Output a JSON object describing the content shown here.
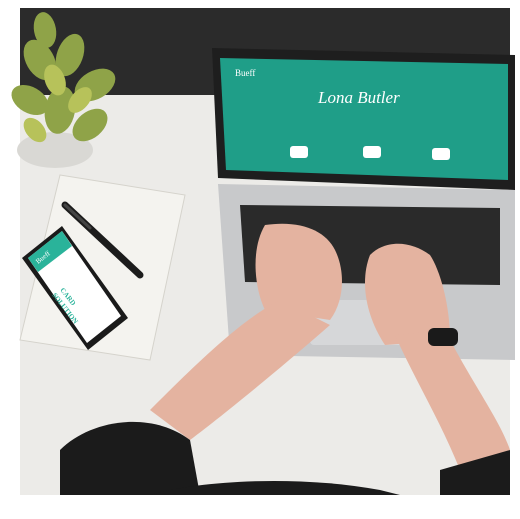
{
  "laptop_screen": {
    "brand": "Bueff",
    "title": "Lona Butler",
    "accent_color": "#1f9e88"
  },
  "phone_screen": {
    "brand": "Bueff",
    "headline_line1": "SOLUTION",
    "headline_line2": "CARD",
    "accent_color": "#2ab39a"
  }
}
